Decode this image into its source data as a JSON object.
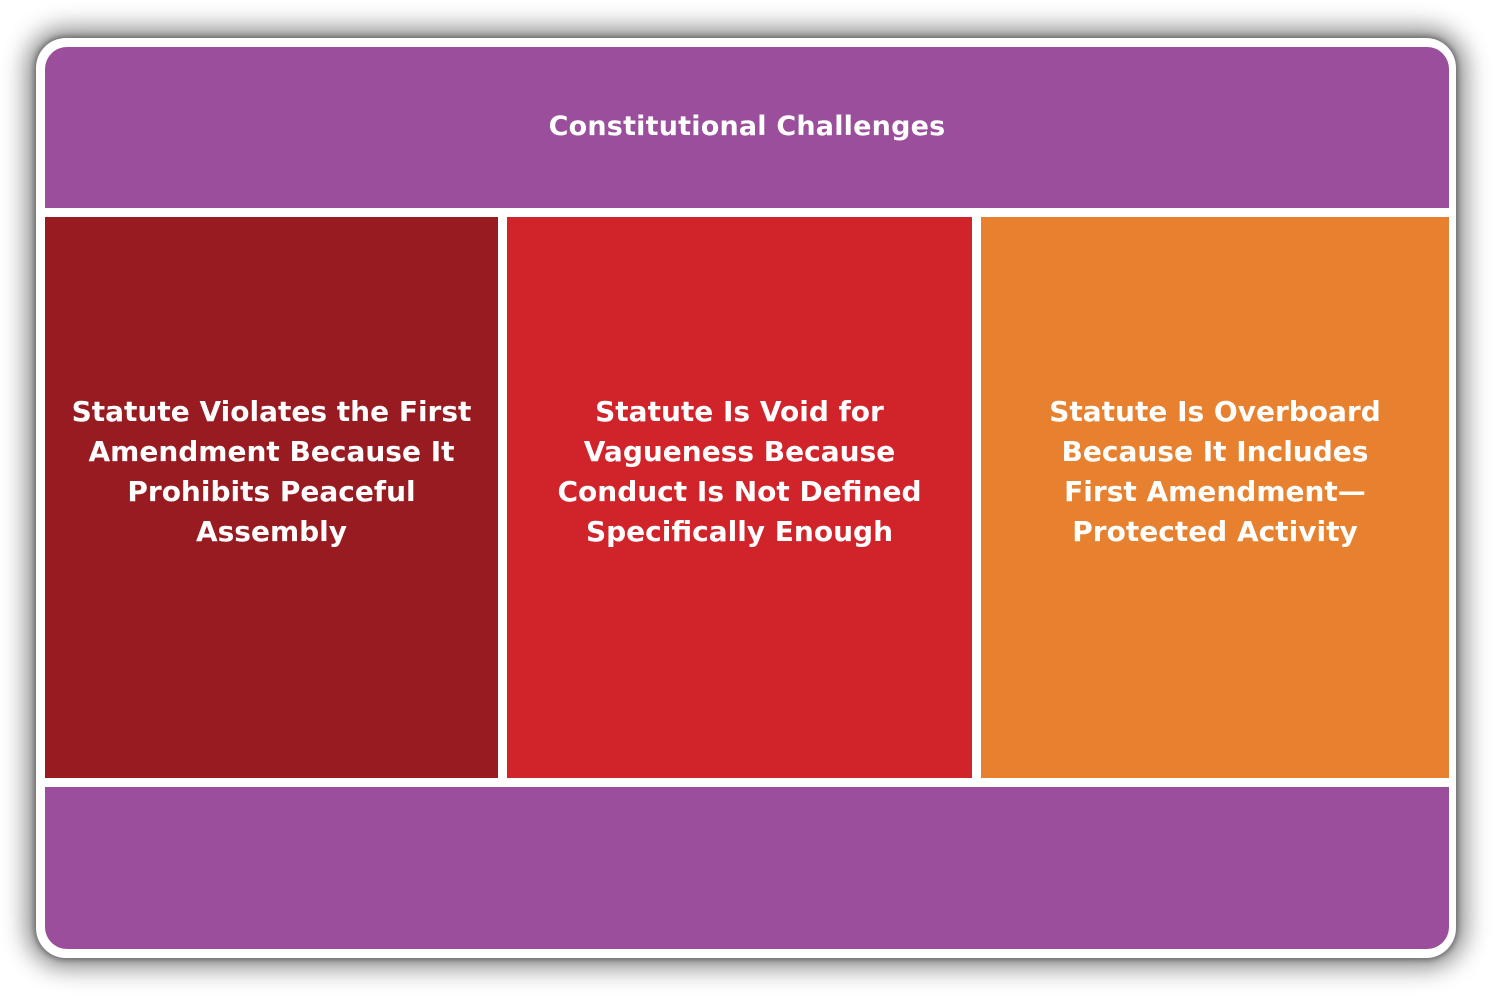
{
  "diagram": {
    "title": "Constitutional Challenges",
    "challenges": [
      {
        "label": "Statute Violates the First\nAmendment Because It\nProhibits Peaceful\nAssembly",
        "color": "#971b20"
      },
      {
        "label": "Statute Is Void for\nVagueness Because\nConduct Is Not Defined\nSpecifically Enough",
        "color": "#d0232a"
      },
      {
        "label": "Statute Is Overboard\nBecause It Includes\nFirst Amendment—\nProtected Activity",
        "color": "#e8812f"
      }
    ],
    "frame_color": "#9a4e9b"
  }
}
